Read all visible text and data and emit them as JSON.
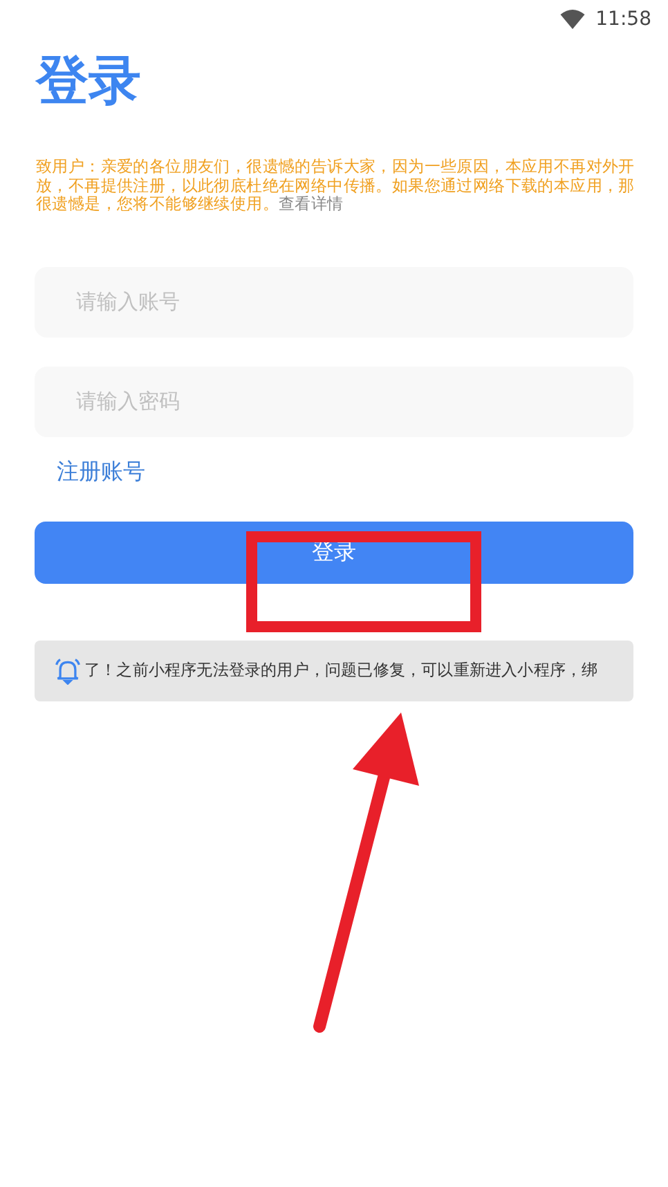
{
  "status_bar": {
    "time": "11:58"
  },
  "title": "登录",
  "notice": {
    "text": "致用户：亲爱的各位朋友们，很遗憾的告诉大家，因为一些原因，本应用不再对外开放，不再提供注册，以此彻底杜绝在网络中传播。如果您通过网络下载的本应用，那很遗憾是，您将不能够继续使用。",
    "link": "查看详情"
  },
  "fields": [
    {
      "placeholder": "请输入账号"
    },
    {
      "placeholder": "请输入密码"
    }
  ],
  "register_link": "注册账号",
  "login_button": "登录",
  "marquee": {
    "text": "了！之前小程序无法登录的用户，问题已修复，可以重新进入小程序，绑"
  }
}
